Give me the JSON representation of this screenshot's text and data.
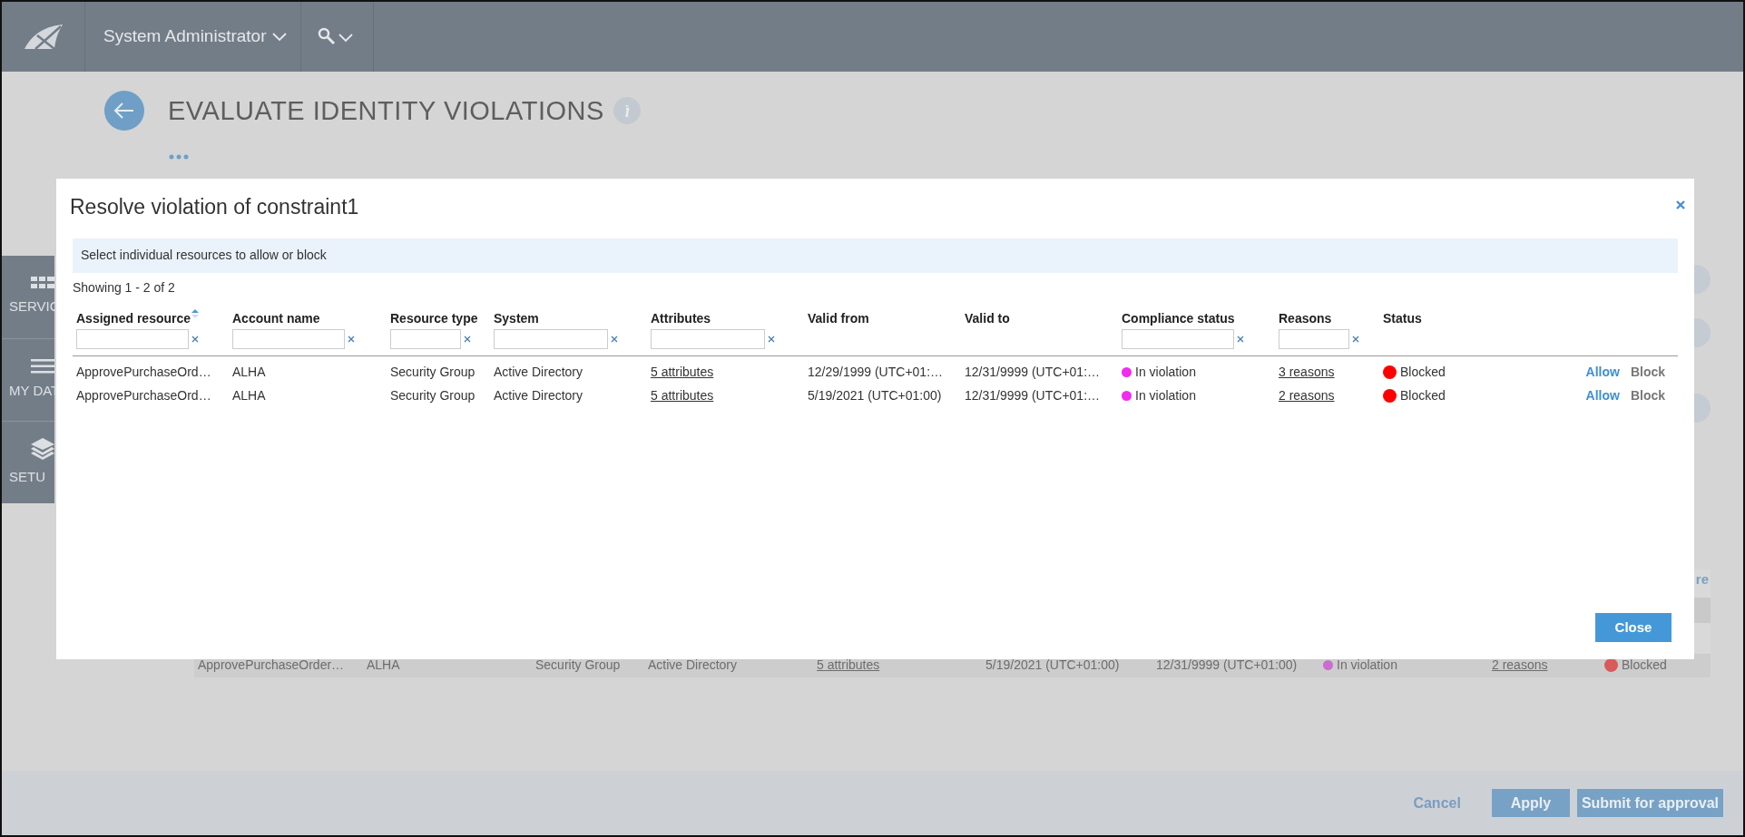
{
  "header": {
    "user_menu": "System Administrator"
  },
  "sidebar": {
    "items": [
      {
        "label": "SERVIC",
        "kind": "grid"
      },
      {
        "label": "MY DAT",
        "kind": "list"
      },
      {
        "label": "SETU",
        "kind": "layers"
      }
    ]
  },
  "page": {
    "title": "EVALUATE IDENTITY VIOLATIONS"
  },
  "background_table": {
    "link_fragment": "re",
    "rows": [
      {
        "cells": [
          "ApprovePurchaseOrder…",
          "ALHA",
          "Security Group",
          "Active Directory",
          "5 attributes",
          "5/19/2021 (UTC+01:00)",
          "12/31/9999 (UTC+01:00)",
          {
            "text": "In violation",
            "color": "#c96ed0"
          },
          "2 reasons",
          {
            "text": "Blocked",
            "color": "#d85a5a"
          }
        ]
      }
    ]
  },
  "modal": {
    "title": "Resolve violation of constraint1",
    "hint": "Select individual resources to allow or block",
    "count": "Showing 1 - 2 of 2",
    "columns": [
      {
        "label": "Assigned resource",
        "kind": "text",
        "sorted": true,
        "filter": true
      },
      {
        "label": "Account name",
        "kind": "text",
        "sorted": false,
        "filter": true
      },
      {
        "label": "Resource type",
        "kind": "text",
        "sorted": false,
        "filter": true
      },
      {
        "label": "System",
        "kind": "text",
        "sorted": false,
        "filter": true
      },
      {
        "label": "Attributes",
        "kind": "link",
        "sorted": false,
        "filter": true
      },
      {
        "label": "Valid from",
        "kind": "text",
        "sorted": false,
        "filter": false
      },
      {
        "label": "Valid to",
        "kind": "text",
        "sorted": false,
        "filter": false
      },
      {
        "label": "Compliance status",
        "kind": "dot",
        "sorted": false,
        "filter": true
      },
      {
        "label": "Reasons",
        "kind": "link",
        "sorted": false,
        "filter": true
      },
      {
        "label": "Status",
        "kind": "dot",
        "sorted": false,
        "filter": false
      }
    ],
    "rows": [
      {
        "cells": [
          "ApprovePurchaseOrd…",
          "ALHA",
          "Security Group",
          "Active Directory",
          "5 attributes",
          "12/29/1999 (UTC+01:…",
          "12/31/9999 (UTC+01:…",
          {
            "text": "In violation",
            "color": "#f02cf0"
          },
          "3 reasons",
          {
            "text": "Blocked",
            "color": "#ff0000"
          }
        ],
        "actions": [
          {
            "label": "Allow",
            "kind": "allow"
          },
          {
            "label": "Block",
            "kind": "block"
          }
        ]
      },
      {
        "cells": [
          "ApprovePurchaseOrd…",
          "ALHA",
          "Security Group",
          "Active Directory",
          "5 attributes",
          "5/19/2021 (UTC+01:00)",
          "12/31/9999 (UTC+01:…",
          {
            "text": "In violation",
            "color": "#f02cf0"
          },
          "2 reasons",
          {
            "text": "Blocked",
            "color": "#ff0000"
          }
        ],
        "actions": [
          {
            "label": "Allow",
            "kind": "allow"
          },
          {
            "label": "Block",
            "kind": "block"
          }
        ]
      }
    ],
    "close_button": "Close"
  },
  "footer": {
    "buttons": [
      {
        "label": "Cancel",
        "kind": "link"
      },
      {
        "label": "Apply",
        "kind": "primary"
      },
      {
        "label": "Submit for approval",
        "kind": "primary"
      }
    ]
  }
}
